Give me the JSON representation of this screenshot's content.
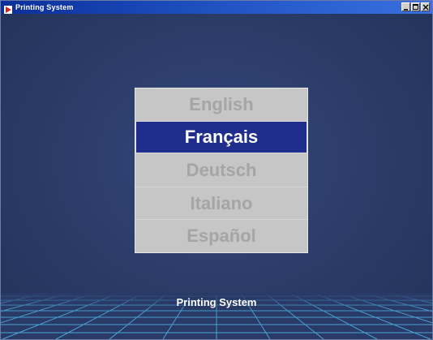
{
  "window": {
    "title": "Printing System"
  },
  "languages": {
    "items": [
      {
        "label": "English",
        "selected": false
      },
      {
        "label": "Français",
        "selected": true
      },
      {
        "label": "Deutsch",
        "selected": false
      },
      {
        "label": "Italiano",
        "selected": false
      },
      {
        "label": "Español",
        "selected": false
      }
    ]
  },
  "footer": {
    "label": "Printing System"
  },
  "colors": {
    "background": "#2b3c68",
    "selected_item": "#1f2e8c",
    "panel": "#c6c6c6",
    "grid": "#4fb6e8"
  },
  "icons": {
    "app": "app-arrow-icon",
    "minimize": "minimize-icon",
    "maximize": "maximize-icon",
    "close": "close-icon"
  }
}
